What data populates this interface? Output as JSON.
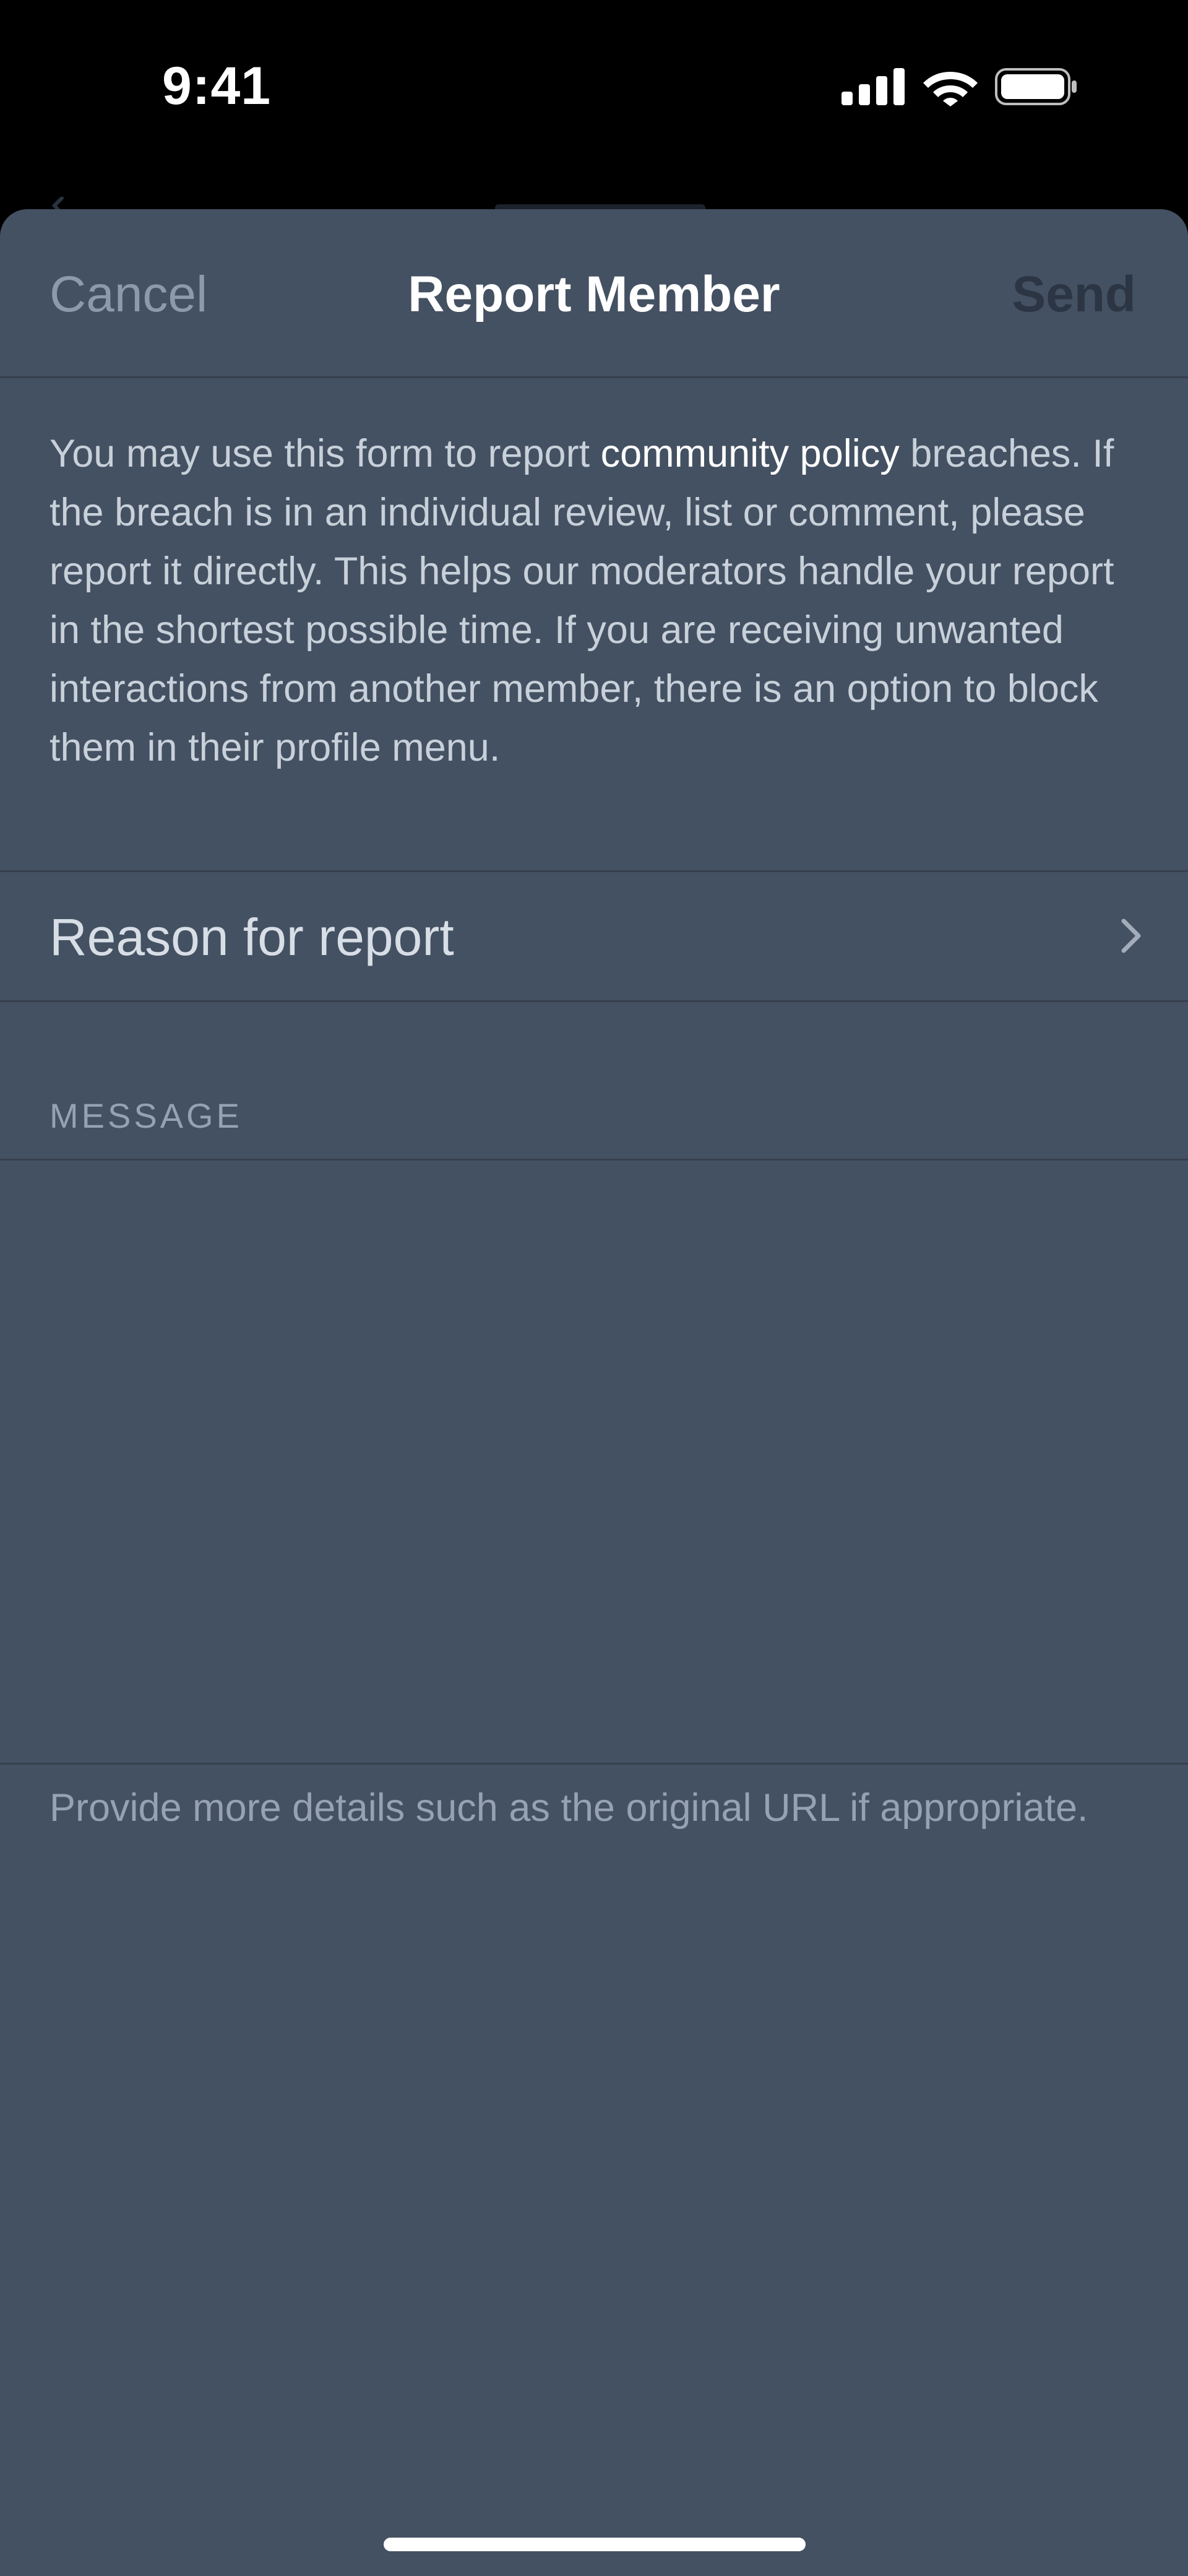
{
  "status_bar": {
    "time": "9:41",
    "icons": [
      "signal-icon",
      "wifi-icon",
      "battery-icon"
    ]
  },
  "nav": {
    "cancel_label": "Cancel",
    "title": "Report Member",
    "send_label": "Send"
  },
  "intro": {
    "text_before_link": "You may use this form to report ",
    "link_text": "community policy",
    "text_after_link": " breaches. If the breach is in an individual review, list or comment, please report it directly. This helps our moderators handle your report in the shortest possible time. If you are receiving unwanted interactions from another member, there is an option to block them in their profile menu."
  },
  "reason": {
    "label": "Reason for report",
    "icon": "chevron-right-icon"
  },
  "message": {
    "section_header": "MESSAGE",
    "value": "",
    "hint": "Provide more details such as the original URL if appropriate."
  },
  "colors": {
    "sheet_background": "#445162",
    "link": "#ffffff",
    "secondary_text": "#96a2b2",
    "send_disabled": "#2b3543"
  }
}
